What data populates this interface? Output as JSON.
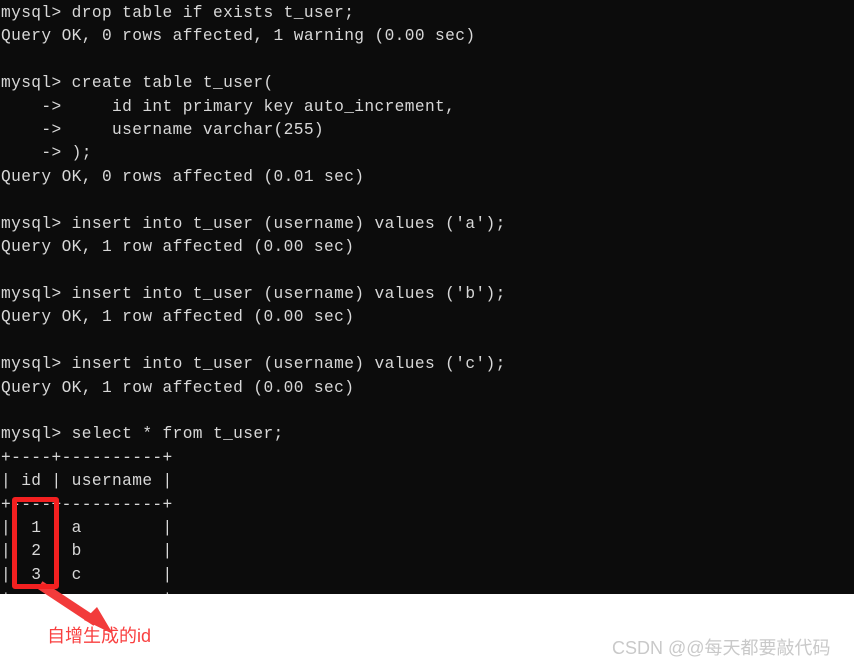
{
  "terminal": {
    "background_color": "#0c0c0c",
    "text_color": "#d8d8d8",
    "prompt": "mysql>",
    "continuation_prompt": "->",
    "lines": [
      "mysql> drop table if exists t_user;",
      "Query OK, 0 rows affected, 1 warning (0.00 sec)",
      "",
      "mysql> create table t_user(",
      "    ->     id int primary key auto_increment,",
      "    ->     username varchar(255)",
      "    -> );",
      "Query OK, 0 rows affected (0.01 sec)",
      "",
      "mysql> insert into t_user (username) values ('a');",
      "Query OK, 1 row affected (0.00 sec)",
      "",
      "mysql> insert into t_user (username) values ('b');",
      "Query OK, 1 row affected (0.00 sec)",
      "",
      "mysql> insert into t_user (username) values ('c');",
      "Query OK, 1 row affected (0.00 sec)",
      "",
      "mysql> select * from t_user;",
      "+----+----------+",
      "| id | username |",
      "+----+----------+",
      "|  1 | a        |",
      "|  2 | b        |",
      "|  3 | c        |",
      "+----+----------+"
    ],
    "commands": [
      "drop table if exists t_user;",
      "create table t_user( id int primary key auto_increment, username varchar(255) );",
      "insert into t_user (username) values ('a');",
      "insert into t_user (username) values ('b');",
      "insert into t_user (username) values ('c');",
      "select * from t_user;"
    ],
    "result_table": {
      "columns": [
        "id",
        "username"
      ],
      "rows": [
        [
          "1",
          "a"
        ],
        [
          "2",
          "b"
        ],
        [
          "3",
          "c"
        ]
      ]
    }
  },
  "annotation": {
    "label": "自增生成的id",
    "color": "#f94040",
    "highlight_box_color": "#f32020",
    "arrow_color": "#f23b3b"
  },
  "watermark": {
    "text": "CSDN @@每天都要敲代码",
    "color": "#c9c9c9"
  }
}
